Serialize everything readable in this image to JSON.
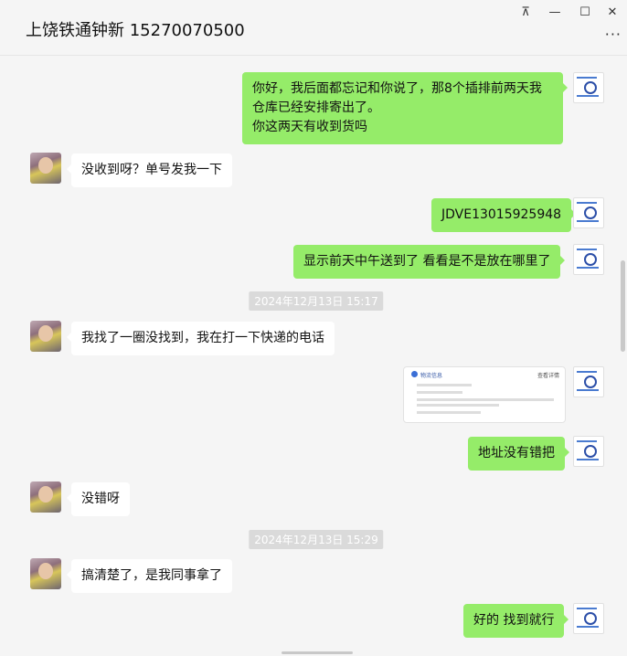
{
  "window": {
    "title": "上饶铁通钟新 15270070500",
    "controls": {
      "pin": "⊼",
      "minimize": "—",
      "maximize": "☐",
      "close": "✕"
    },
    "more": "···"
  },
  "messages": [
    {
      "side": "out",
      "text": "你好，我后面都忘记和你说了，那8个插排前两天我仓库已经安排寄出了。\n你这两天有收到货吗"
    },
    {
      "side": "in",
      "text": "没收到呀？单号发我一下"
    },
    {
      "side": "out",
      "text": "JDVE13015925948"
    },
    {
      "side": "out",
      "text": "显示前天中午送到了  看看是不是放在哪里了"
    },
    {
      "type": "time",
      "text": "2024年12月13日 15:17"
    },
    {
      "side": "in",
      "text": "我找了一圈没找到，我在打一下快递的电话"
    },
    {
      "side": "out",
      "type": "card"
    },
    {
      "side": "out",
      "text": "地址没有错把"
    },
    {
      "side": "in",
      "text": "没错呀"
    },
    {
      "type": "time",
      "text": "2024年12月13日 15:29"
    },
    {
      "side": "in",
      "text": "搞清楚了，是我同事拿了"
    },
    {
      "side": "out",
      "text": "好的 找到就行"
    }
  ],
  "card": {
    "header": "物流信息",
    "action": "查看详情"
  },
  "colors": {
    "outgoing_bubble": "#95ec69",
    "incoming_bubble": "#ffffff",
    "background": "#f5f5f5"
  }
}
